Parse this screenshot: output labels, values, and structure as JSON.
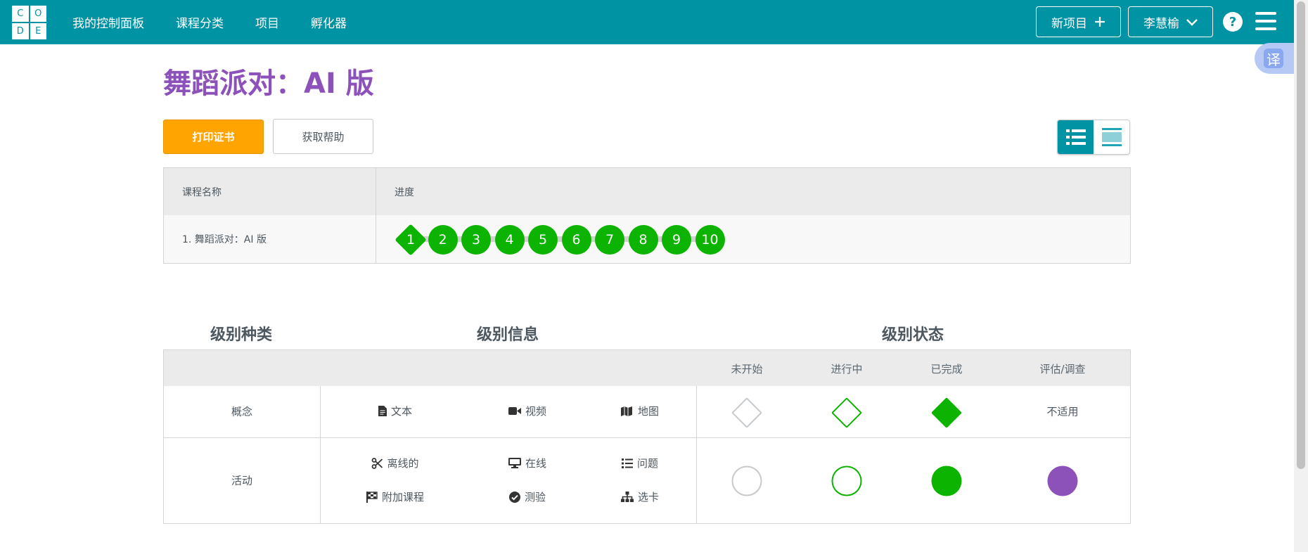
{
  "header": {
    "logo_letters": [
      "C",
      "O",
      "D",
      "E"
    ],
    "nav": [
      "我的控制面板",
      "课程分类",
      "项目",
      "孵化器"
    ],
    "new_project_label": "新项目",
    "user_name": "李慧榆",
    "help_label": "?",
    "translate_label": "译",
    "colors": {
      "bar": "#0093a4"
    }
  },
  "page": {
    "title": "舞蹈派对：AI 版",
    "print_button": "打印证书",
    "help_button": "获取帮助",
    "title_color": "#8c52ba"
  },
  "progress_table": {
    "col_lesson": "课程名称",
    "col_progress": "进度",
    "lesson_name": "1. 舞蹈派对：AI 版",
    "levels": [
      "1",
      "2",
      "3",
      "4",
      "5",
      "6",
      "7",
      "8",
      "9",
      "10"
    ],
    "level_status": "completed",
    "first_level_shape": "diamond",
    "completed_color": "#0cb300"
  },
  "legend": {
    "heading_type": "级别种类",
    "heading_info": "级别信息",
    "heading_status": "级别状态",
    "status_columns": [
      "未开始",
      "进行中",
      "已完成",
      "评估/调查"
    ],
    "rows": {
      "concept": {
        "label": "概念",
        "items": [
          "文本",
          "视频",
          "地图"
        ],
        "na_label": "不适用"
      },
      "activity": {
        "label": "活动",
        "items": [
          "离线的",
          "在线",
          "问题",
          "附加课程",
          "测验",
          "选卡"
        ]
      }
    },
    "assessment_color": "#8c52ba"
  }
}
